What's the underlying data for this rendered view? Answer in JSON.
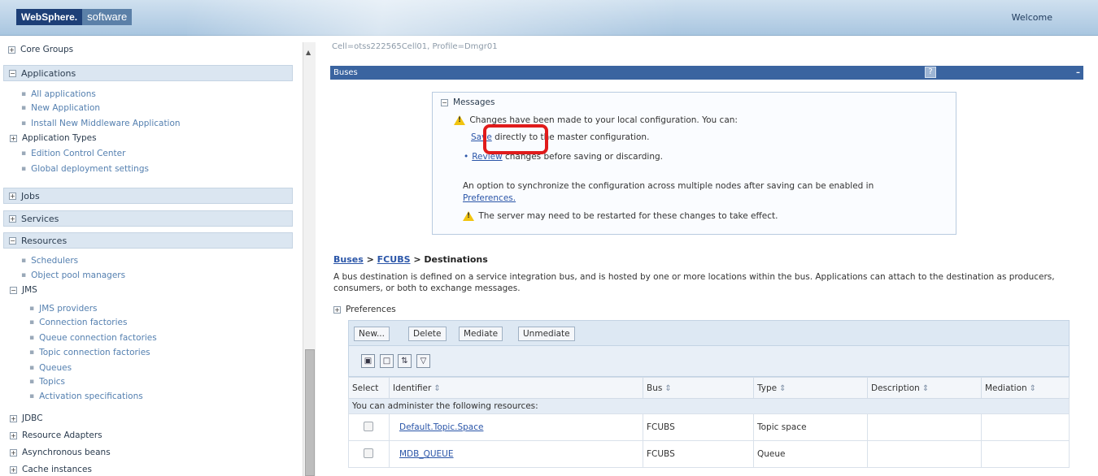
{
  "banner": {
    "logo_brand": "WebSphere.",
    "logo_suffix": "software",
    "welcome": "Welcome"
  },
  "nav": {
    "core_groups": "Core Groups",
    "applications": "Applications",
    "app_items": [
      "All applications",
      "New Application",
      "Install New Middleware Application"
    ],
    "application_types": "Application Types",
    "app_items2": [
      "Edition Control Center",
      "Global deployment settings"
    ],
    "jobs": "Jobs",
    "services": "Services",
    "resources": "Resources",
    "res_items": [
      "Schedulers",
      "Object pool managers"
    ],
    "jms": "JMS",
    "jms_items": [
      "JMS providers",
      "Connection factories",
      "Queue connection factories",
      "Topic connection factories",
      "Queues",
      "Topics",
      "Activation specifications"
    ],
    "jdbc": "JDBC",
    "resource_adapters": "Resource Adapters",
    "async_beans": "Asynchronous beans",
    "cache_instances": "Cache instances"
  },
  "main": {
    "cell_path": "Cell=otss222565Cell01, Profile=Dmgr01",
    "panel_title": "Buses",
    "help": "?",
    "minimize": "–",
    "messages": {
      "header": "Messages",
      "line1": "Changes have been made to your local configuration. You can:",
      "save_link": "Save",
      "line2_rest": " directly to the master configuration.",
      "review_link": "Review",
      "line3_rest": " changes before saving or discarding.",
      "line4": "An option to synchronize the configuration across multiple nodes after saving can be enabled in",
      "preferences_link": "Preferences.",
      "line5": "The server may need to be restarted for these changes to take effect."
    },
    "breadcrumb": {
      "buses": "Buses",
      "sep": " > ",
      "fcubs": "FCUBS",
      "current": "Destinations"
    },
    "description": "A bus destination is defined on a service integration bus, and is hosted by one or more locations within the bus. Applications can attach to the destination as producers, consumers, or both to exchange messages.",
    "preferences": "Preferences",
    "buttons": {
      "new": "New...",
      "delete": "Delete",
      "mediate": "Mediate",
      "unmediate": "Unmediate"
    },
    "table": {
      "headers": {
        "select": "Select",
        "identifier": "Identifier",
        "bus": "Bus",
        "type": "Type",
        "description": "Description",
        "mediation": "Mediation"
      },
      "note": "You can administer the following resources:",
      "rows": [
        {
          "identifier": "Default.Topic.Space",
          "bus": "FCUBS",
          "type": "Topic space",
          "description": "",
          "mediation": ""
        },
        {
          "identifier": "MDB_QUEUE",
          "bus": "FCUBS",
          "type": "Queue",
          "description": "",
          "mediation": ""
        }
      ]
    }
  }
}
